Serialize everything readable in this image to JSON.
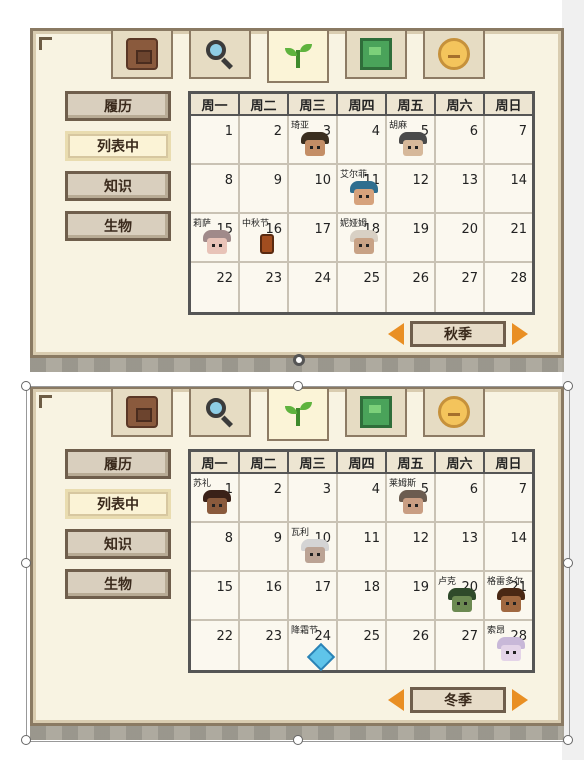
{
  "tabs": [
    {
      "name": "inventory-tab",
      "icon": "backpack-icon"
    },
    {
      "name": "search-tab",
      "icon": "magnifier-icon"
    },
    {
      "name": "calendar-tab",
      "icon": "sprout-icon"
    },
    {
      "name": "map-tab",
      "icon": "map-icon"
    },
    {
      "name": "friends-tab",
      "icon": "smiley-face-icon"
    }
  ],
  "menu": [
    "履历",
    "列表中",
    "知识",
    "生物"
  ],
  "menu_selected_index": 1,
  "weekdays": [
    "周一",
    "周二",
    "周三",
    "周四",
    "周五",
    "周六",
    "周日"
  ],
  "calendars": [
    {
      "season_label": "秋季",
      "events": [
        {
          "day": 3,
          "label": "琦亚",
          "kind": "portrait",
          "hair": "#3a2e1f",
          "skin": "#c48e66"
        },
        {
          "day": 5,
          "label": "胡麻",
          "kind": "portrait",
          "hair": "#4a4a4a",
          "skin": "#d6b89a"
        },
        {
          "day": 11,
          "label": "艾尔菲",
          "kind": "portrait",
          "hair": "#2f6e8f",
          "skin": "#d6a27c"
        },
        {
          "day": 15,
          "label": "莉萨",
          "kind": "portrait",
          "hair": "#a08a8a",
          "skin": "#e8c3b8"
        },
        {
          "day": 16,
          "label": "中秋节",
          "kind": "bag"
        },
        {
          "day": 18,
          "label": "妮娅姆",
          "kind": "portrait",
          "hair": "#d8d0c4",
          "skin": "#c8a285"
        }
      ]
    },
    {
      "season_label": "冬季",
      "events": [
        {
          "day": 1,
          "label": "苏礼",
          "kind": "portrait",
          "hair": "#3a2118",
          "skin": "#8a5a3c"
        },
        {
          "day": 5,
          "label": "莱姆斯",
          "kind": "portrait",
          "hair": "#6b5c50",
          "skin": "#c99e83"
        },
        {
          "day": 10,
          "label": "瓦利",
          "kind": "portrait",
          "hair": "#d4d4d4",
          "skin": "#bba394"
        },
        {
          "day": 20,
          "label": "卢克",
          "kind": "portrait",
          "hair": "#2f4a2a",
          "skin": "#6c8a52"
        },
        {
          "day": 21,
          "label": "格雷多尔",
          "kind": "portrait",
          "hair": "#4a2814",
          "skin": "#a06840"
        },
        {
          "day": 24,
          "label": "降霜节",
          "kind": "snowflake"
        },
        {
          "day": 28,
          "label": "索昂",
          "kind": "portrait",
          "hair": "#c8b8d8",
          "skin": "#e4d4e8"
        }
      ]
    }
  ],
  "colors": {
    "accent_arrow": "#e98f24",
    "panel_bg": "#f8f3e2",
    "border": "#6f5e4c"
  }
}
